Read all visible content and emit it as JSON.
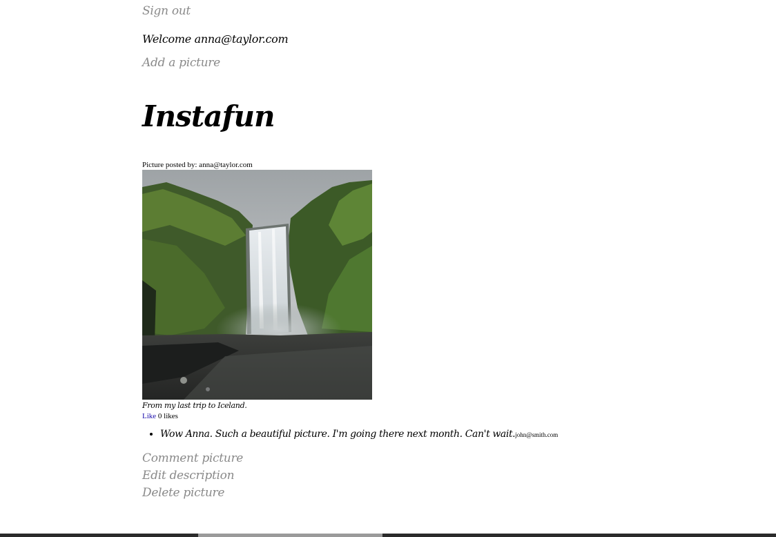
{
  "nav": {
    "sign_out": "Sign out",
    "welcome": "Welcome anna@taylor.com",
    "add_picture": "Add a picture"
  },
  "site_title": "Instafun",
  "post": {
    "posted_by": "Picture posted by: anna@taylor.com",
    "caption": "From my last trip to Iceland.",
    "like_label": "Like",
    "likes_count": "0 likes",
    "comments": [
      {
        "text": "Wow Anna. Such a beautiful picture. I'm going there next month. Can't wait.",
        "author": "john@smith.com"
      }
    ],
    "actions": {
      "comment": "Comment picture",
      "edit": "Edit description",
      "delete": "Delete picture"
    }
  },
  "colors": {
    "link_gray": "#8a8a8a",
    "like_blue": "#1a0dab"
  }
}
